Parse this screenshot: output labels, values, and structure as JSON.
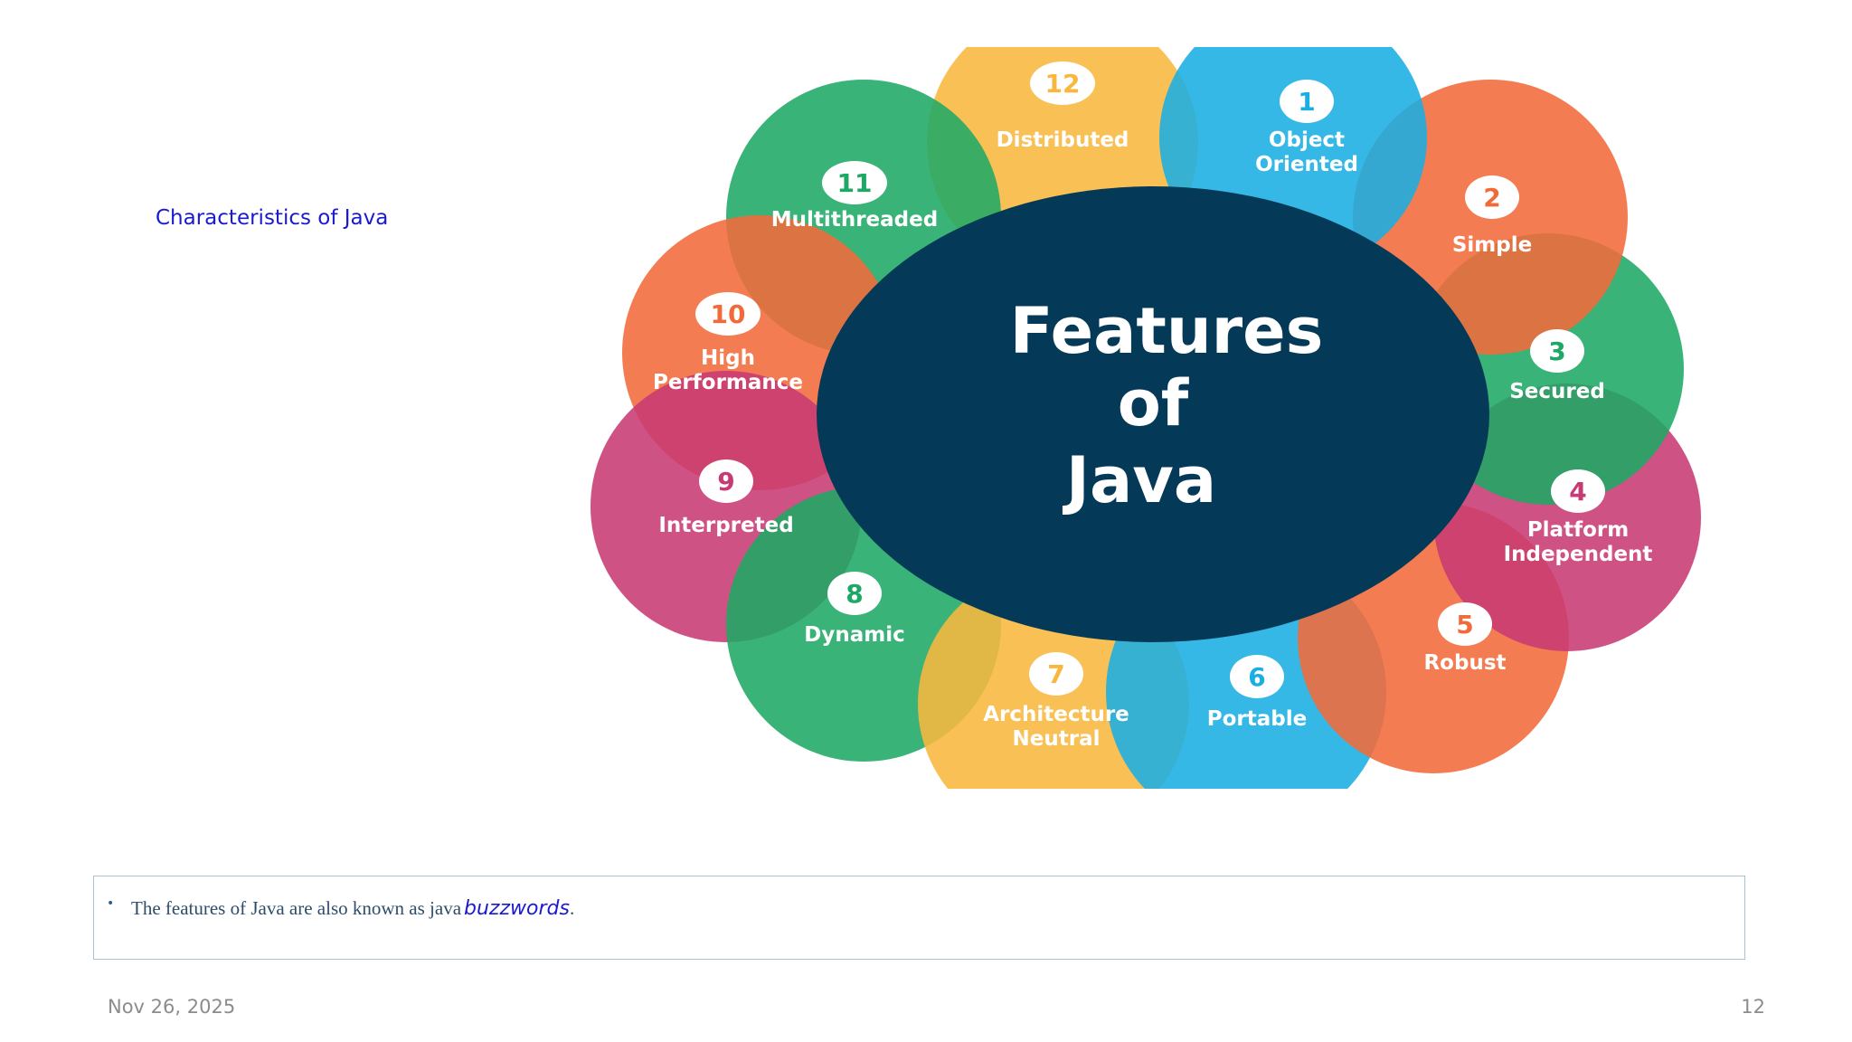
{
  "slide": {
    "title": "Characteristics of Java"
  },
  "diagram": {
    "center_lines": [
      "Features",
      "of",
      "Java"
    ],
    "center_color": "#043a57",
    "features": [
      {
        "num": "1",
        "lines": [
          "Object",
          "Oriented"
        ],
        "color": "#1aaee2"
      },
      {
        "num": "2",
        "lines": [
          "Simple"
        ],
        "color": "#f26a3a"
      },
      {
        "num": "3",
        "lines": [
          "Secured"
        ],
        "color": "#1fa865"
      },
      {
        "num": "4",
        "lines": [
          "Platform",
          "Independent"
        ],
        "color": "#c83a73"
      },
      {
        "num": "5",
        "lines": [
          "Robust"
        ],
        "color": "#f26a3a"
      },
      {
        "num": "6",
        "lines": [
          "Portable"
        ],
        "color": "#1aaee2"
      },
      {
        "num": "7",
        "lines": [
          "Architecture",
          "Neutral"
        ],
        "color": "#f8b73e"
      },
      {
        "num": "8",
        "lines": [
          "Dynamic"
        ],
        "color": "#1fa865"
      },
      {
        "num": "9",
        "lines": [
          "Interpreted"
        ],
        "color": "#c83a73"
      },
      {
        "num": "10",
        "lines": [
          "High",
          "Performance"
        ],
        "color": "#f26a3a"
      },
      {
        "num": "11",
        "lines": [
          "Multithreaded"
        ],
        "color": "#1fa865"
      },
      {
        "num": "12",
        "lines": [
          "Distributed"
        ],
        "color": "#f8b73e"
      }
    ]
  },
  "note": {
    "bullet": "•",
    "text": "The features of Java are also known as java",
    "emphasis": "buzzwords",
    "period": "."
  },
  "footer": {
    "date": "Nov 26, 2025",
    "page": "12"
  }
}
